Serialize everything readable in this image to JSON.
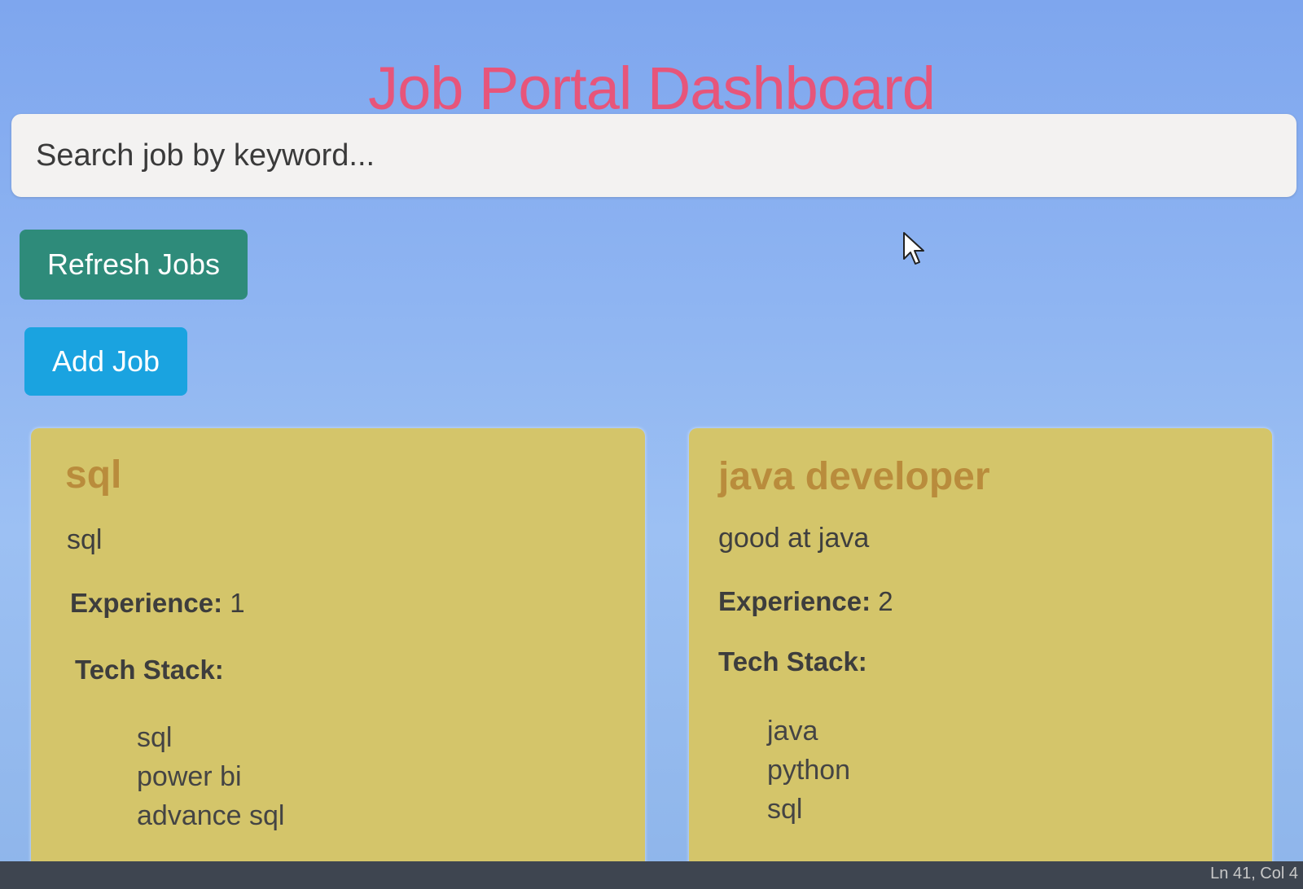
{
  "header": {
    "title": "Job Portal Dashboard"
  },
  "search": {
    "placeholder": "Search job by keyword..."
  },
  "actions": {
    "refresh_label": "Refresh Jobs",
    "add_label": "Add Job"
  },
  "jobs": [
    {
      "title": "sql",
      "description": "sql",
      "experience_label": "Experience:",
      "experience": "1",
      "stack_label": "Tech Stack:",
      "stack": [
        "sql",
        "power bi",
        "advance sql"
      ]
    },
    {
      "title": "java developer",
      "description": "good at java",
      "experience_label": "Experience:",
      "experience": "2",
      "stack_label": "Tech Stack:",
      "stack": [
        "java",
        "python",
        "sql"
      ]
    }
  ],
  "statusbar": {
    "position": "Ln 41, Col 4"
  },
  "colors": {
    "title": "#e7557a",
    "refresh_button": "#2e8b7a",
    "add_button": "#1aa3e0",
    "card_background": "#d4c56a",
    "card_title": "#b98c3c"
  }
}
